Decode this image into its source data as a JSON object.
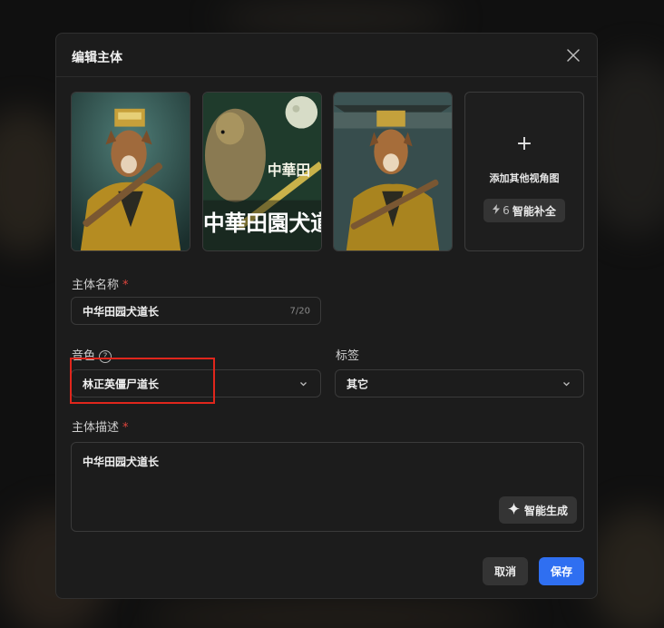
{
  "dialog": {
    "title": "编辑主体",
    "add_view_label": "添加其他视角图",
    "smart_fill_cost": "6",
    "smart_fill_label": "智能补全"
  },
  "images": [
    {
      "alt": "dog-priest-portrait-1",
      "text": ""
    },
    {
      "alt": "dog-priest-portrait-2",
      "text": "中華田園犬道"
    },
    {
      "alt": "dog-priest-portrait-3",
      "text": ""
    }
  ],
  "form": {
    "name_label": "主体名称",
    "name_value": "中华田园犬道长",
    "name_count": "7/20",
    "voice_label": "音色",
    "voice_value": "林正英僵尸道长",
    "tag_label": "标签",
    "tag_value": "其它",
    "desc_label": "主体描述",
    "desc_value": "中华田园犬道长",
    "generate_label": "智能生成",
    "required_mark": "*"
  },
  "footer": {
    "cancel_label": "取消",
    "save_label": "保存"
  },
  "colors": {
    "accent": "#2f6ff1",
    "required": "#e0453d",
    "highlight": "#e0261c"
  }
}
